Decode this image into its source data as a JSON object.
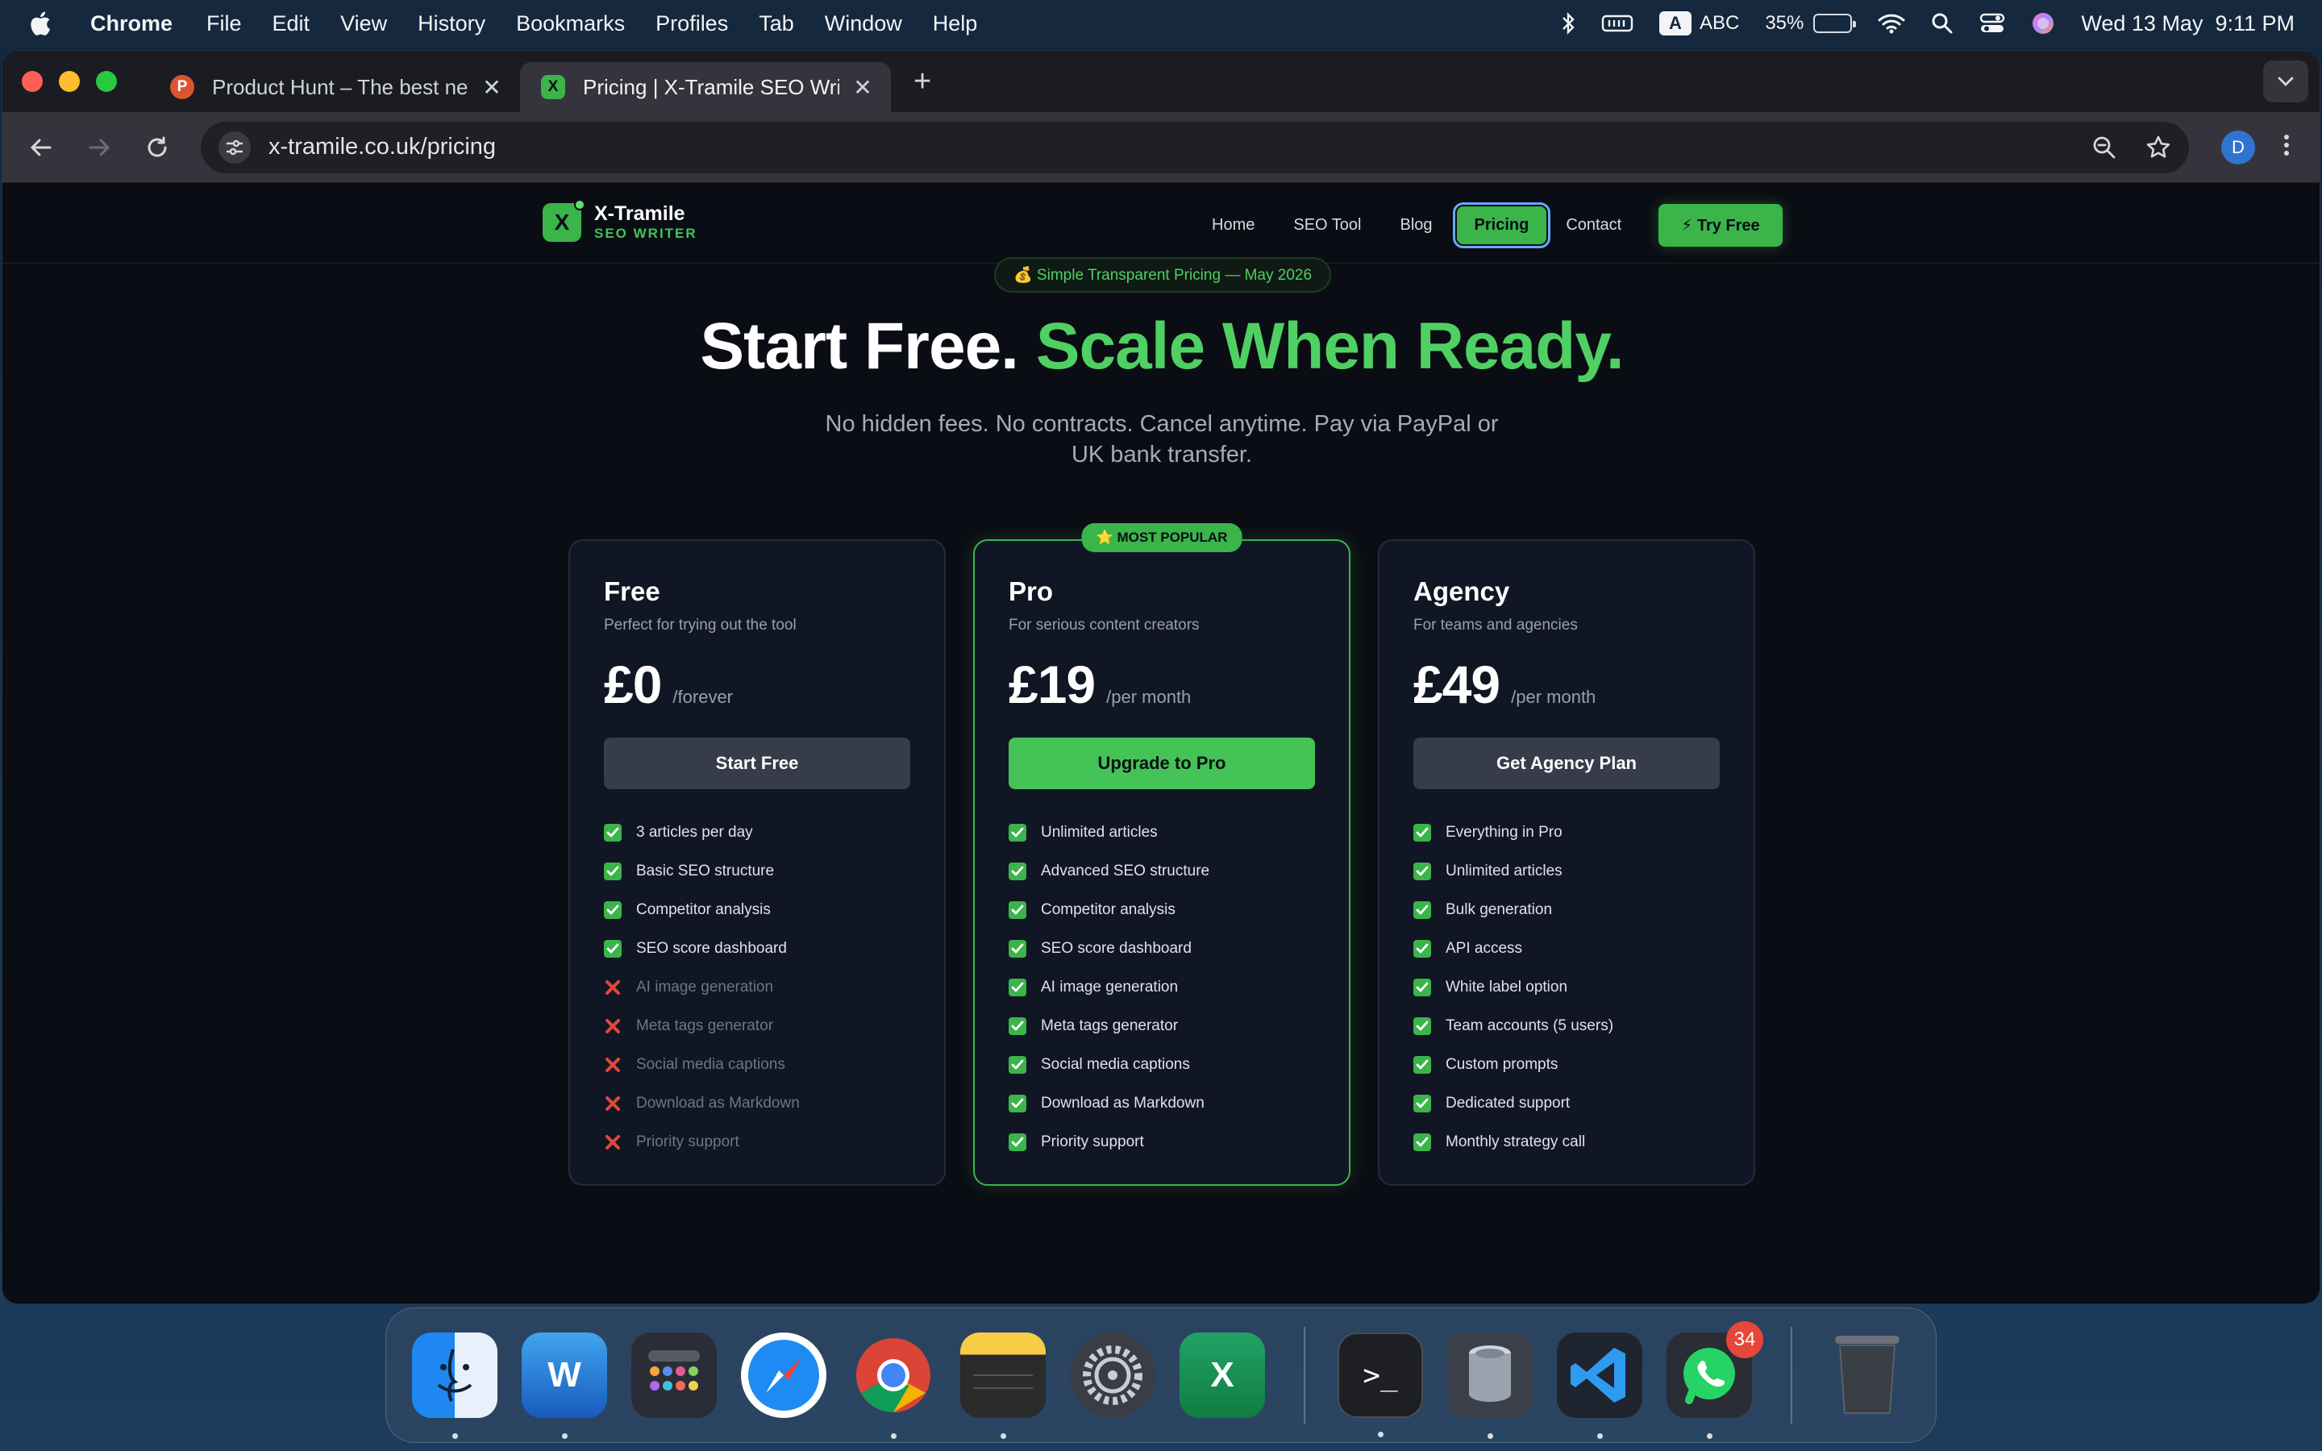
{
  "menubar": {
    "app": "Chrome",
    "menus": [
      "File",
      "Edit",
      "View",
      "History",
      "Bookmarks",
      "Profiles",
      "Tab",
      "Window",
      "Help"
    ],
    "input_source": "ABC",
    "input_letter": "A",
    "battery_pct": "35%",
    "battery_level": 0.35,
    "datetime": "Wed 13 May  9:11 PM"
  },
  "browser": {
    "tabs": [
      {
        "favicon": "P",
        "favicon_color": "#da552f",
        "title": "Product Hunt – The best new products in tech.",
        "close": "✕"
      },
      {
        "favicon": "X",
        "favicon_color": "#3bb44a",
        "title": "Pricing | X-Tramile SEO Writer",
        "close": "✕"
      }
    ],
    "new_tab": "+",
    "url": "x-tramile.co.uk/pricing",
    "profile_initial": "D"
  },
  "site": {
    "logo_mark": "X",
    "logo_name": "X-Tramile",
    "logo_sub": "SEO WRITER",
    "nav": [
      "Home",
      "SEO Tool",
      "Blog",
      "Pricing",
      "Contact"
    ],
    "cta": "⚡ Try Free"
  },
  "hero": {
    "badge": "💰 Simple Transparent Pricing — May 2026",
    "title_white": "Start Free.",
    "title_green": "Scale When Ready.",
    "subtitle": "No hidden fees. No contracts. Cancel anytime. Pay via PayPal or UK bank transfer."
  },
  "plans": [
    {
      "name": "Free",
      "desc": "Perfect for trying out the tool",
      "price": "£0",
      "period": "/forever",
      "button": "Start Free",
      "features": [
        {
          "text": "3 articles per day",
          "included": true
        },
        {
          "text": "Basic SEO structure",
          "included": true
        },
        {
          "text": "Competitor analysis",
          "included": true
        },
        {
          "text": "SEO score dashboard",
          "included": true
        },
        {
          "text": "AI image generation",
          "included": false
        },
        {
          "text": "Meta tags generator",
          "included": false
        },
        {
          "text": "Social media captions",
          "included": false
        },
        {
          "text": "Download as Markdown",
          "included": false
        },
        {
          "text": "Priority support",
          "included": false
        }
      ]
    },
    {
      "name": "Pro",
      "badge": "⭐ MOST POPULAR",
      "desc": "For serious content creators",
      "price": "£19",
      "period": "/per month",
      "button": "Upgrade to Pro",
      "features": [
        {
          "text": "Unlimited articles",
          "included": true
        },
        {
          "text": "Advanced SEO structure",
          "included": true
        },
        {
          "text": "Competitor analysis",
          "included": true
        },
        {
          "text": "SEO score dashboard",
          "included": true
        },
        {
          "text": "AI image generation",
          "included": true
        },
        {
          "text": "Meta tags generator",
          "included": true
        },
        {
          "text": "Social media captions",
          "included": true
        },
        {
          "text": "Download as Markdown",
          "included": true
        },
        {
          "text": "Priority support",
          "included": true
        }
      ]
    },
    {
      "name": "Agency",
      "desc": "For teams and agencies",
      "price": "£49",
      "period": "/per month",
      "button": "Get Agency Plan",
      "features": [
        {
          "text": "Everything in Pro",
          "included": true
        },
        {
          "text": "Unlimited articles",
          "included": true
        },
        {
          "text": "Bulk generation",
          "included": true
        },
        {
          "text": "API access",
          "included": true
        },
        {
          "text": "White label option",
          "included": true
        },
        {
          "text": "Team accounts (5 users)",
          "included": true
        },
        {
          "text": "Custom prompts",
          "included": true
        },
        {
          "text": "Dedicated support",
          "included": true
        },
        {
          "text": "Monthly strategy call",
          "included": true
        }
      ]
    }
  ],
  "dock": {
    "apps": [
      "finder-icon",
      "word-icon",
      "launchpad-icon",
      "safari-icon",
      "chrome-icon",
      "notes-icon",
      "settings-icon",
      "excel-icon",
      "terminal-icon",
      "disk-utility-icon",
      "vscode-icon",
      "whatsapp-icon",
      "trash-icon"
    ],
    "whatsapp_badge": "34"
  },
  "colors": {
    "accent": "#3bb44a",
    "page_bg": "#0b0d14",
    "card_bg": "#111625"
  }
}
